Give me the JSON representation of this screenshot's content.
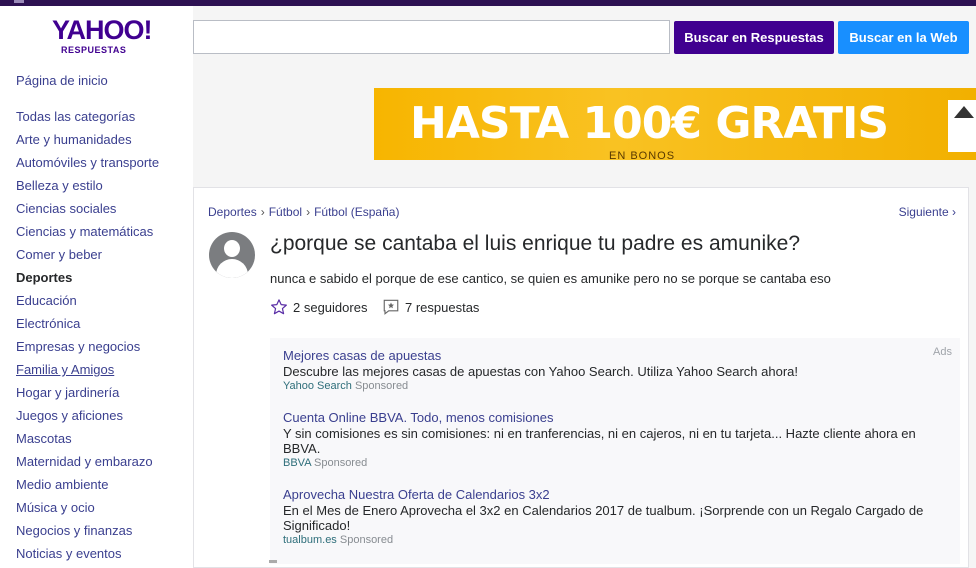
{
  "header": {
    "logo_main": "YAHOO!",
    "logo_sub": "RESPUESTAS",
    "search_placeholder": "",
    "search_answers_label": "Buscar en Respuestas",
    "search_web_label": "Buscar en la Web"
  },
  "sidebar": {
    "home": "Página de inicio",
    "items": [
      "Todas las categorías",
      "Arte y humanidades",
      "Automóviles y transporte",
      "Belleza y estilo",
      "Ciencias sociales",
      "Ciencias y matemáticas",
      "Comer y beber",
      "Deportes",
      "Educación",
      "Electrónica",
      "Empresas y negocios",
      "Familia y Amigos",
      "Hogar y jardinería",
      "Juegos y aficiones",
      "Mascotas",
      "Maternidad y embarazo",
      "Medio ambiente",
      "Música y ocio",
      "Negocios y finanzas",
      "Noticias y eventos"
    ]
  },
  "banner": {
    "headline": "HASTA 100€ GRATIS",
    "subtext": "EN BONOS"
  },
  "question": {
    "breadcrumb": [
      "Deportes",
      "Fútbol",
      "Fútbol (España)"
    ],
    "next_label": "Siguiente",
    "title": "¿porque se cantaba el luis enrique tu padre es amunike?",
    "body": "nunca e sabido el porque de ese cantico, se quien es amunike pero no se porque se cantaba eso",
    "followers": "2 seguidores",
    "answers": "7 respuestas"
  },
  "ads": {
    "tag": "Ads",
    "items": [
      {
        "title": "Mejores casas de apuestas",
        "desc": "Descubre las mejores casas de apuestas con Yahoo Search. Utiliza Yahoo Search ahora!",
        "source": "Yahoo Search",
        "sponsored": "Sponsored"
      },
      {
        "title": "Cuenta Online BBVA. Todo, menos comisiones",
        "desc": "Y sin comisiones es sin comisiones: ni en tranferencias, ni en cajeros, ni en tu tarjeta... Hazte cliente ahora en BBVA.",
        "source": "BBVA",
        "sponsored": "Sponsored"
      },
      {
        "title": "Aprovecha Nuestra Oferta de Calendarios 3x2",
        "desc": "En el Mes de Enero Aprovecha el 3x2 en Calendarios 2017 de tualbum. ¡Sorprende con un Regalo Cargado de Significado!",
        "source": "tualbum.es",
        "sponsored": "Sponsored"
      }
    ]
  },
  "colors": {
    "brand_purple": "#400090",
    "web_blue": "#188fff",
    "link": "#3a3f8f",
    "banner_yellow": "#f7b500"
  }
}
